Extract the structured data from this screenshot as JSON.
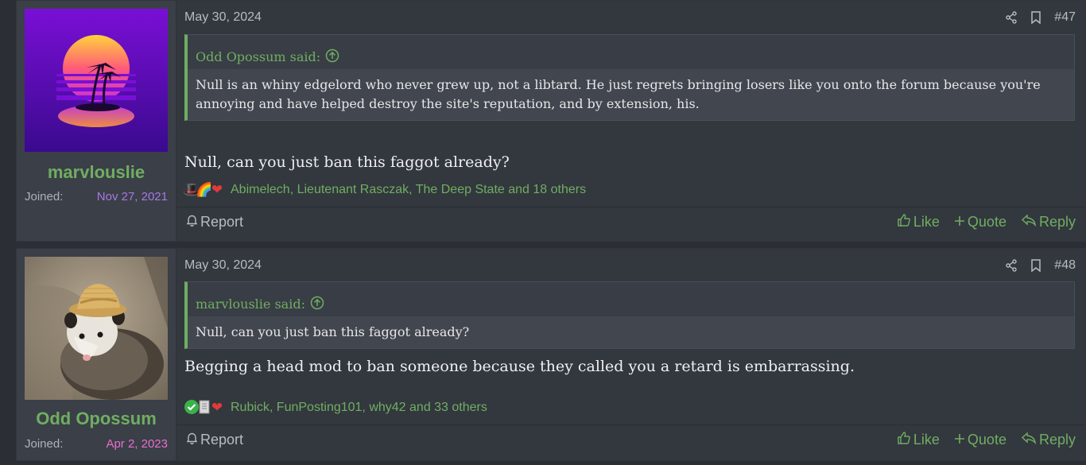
{
  "posts": [
    {
      "username": "marvlouslie",
      "joined_label": "Joined:",
      "joined_date": "Nov 27, 2021",
      "joined_color": "#a678e8",
      "avatar": "synthwave-sunset-palms",
      "date": "May 30, 2024",
      "number": "#47",
      "quote_author": "Odd Opossum said:",
      "quote_text": "Null is an whiny edgelord who never grew up, not a libtard. He just regrets bringing losers like you onto the forum because you're annoying and have helped destroy the site's reputation, and by extension, his.",
      "message": "Null, can you just ban this faggot already?",
      "reaction_icons": [
        "top-hat-icon",
        "rainbow-icon",
        "heart-icon"
      ],
      "reactions_text": "Abimelech, Lieutenant Rasczak, The Deep State and 18 others",
      "report": "Report",
      "like": "Like",
      "quote": "Quote",
      "reply": "Reply"
    },
    {
      "username": "Odd Opossum",
      "joined_label": "Joined:",
      "joined_date": "Apr 2, 2023",
      "joined_color": "#e86fd0",
      "avatar": "opossum-straw-hat",
      "date": "May 30, 2024",
      "number": "#48",
      "quote_author": "marvlouslie said:",
      "quote_text": "Null, can you just ban this faggot already?",
      "message": "Begging a head mod to ban someone because they called you a retard is embarrassing.",
      "reaction_icons": [
        "checkmark-icon",
        "document-icon",
        "heart-icon"
      ],
      "reactions_text": "Rubick, FunPosting101, why42 and 33 others",
      "report": "Report",
      "like": "Like",
      "quote": "Quote",
      "reply": "Reply"
    }
  ],
  "colors": {
    "accent": "#6fae62",
    "background": "#2b2e34",
    "post_bg": "#33373e"
  }
}
